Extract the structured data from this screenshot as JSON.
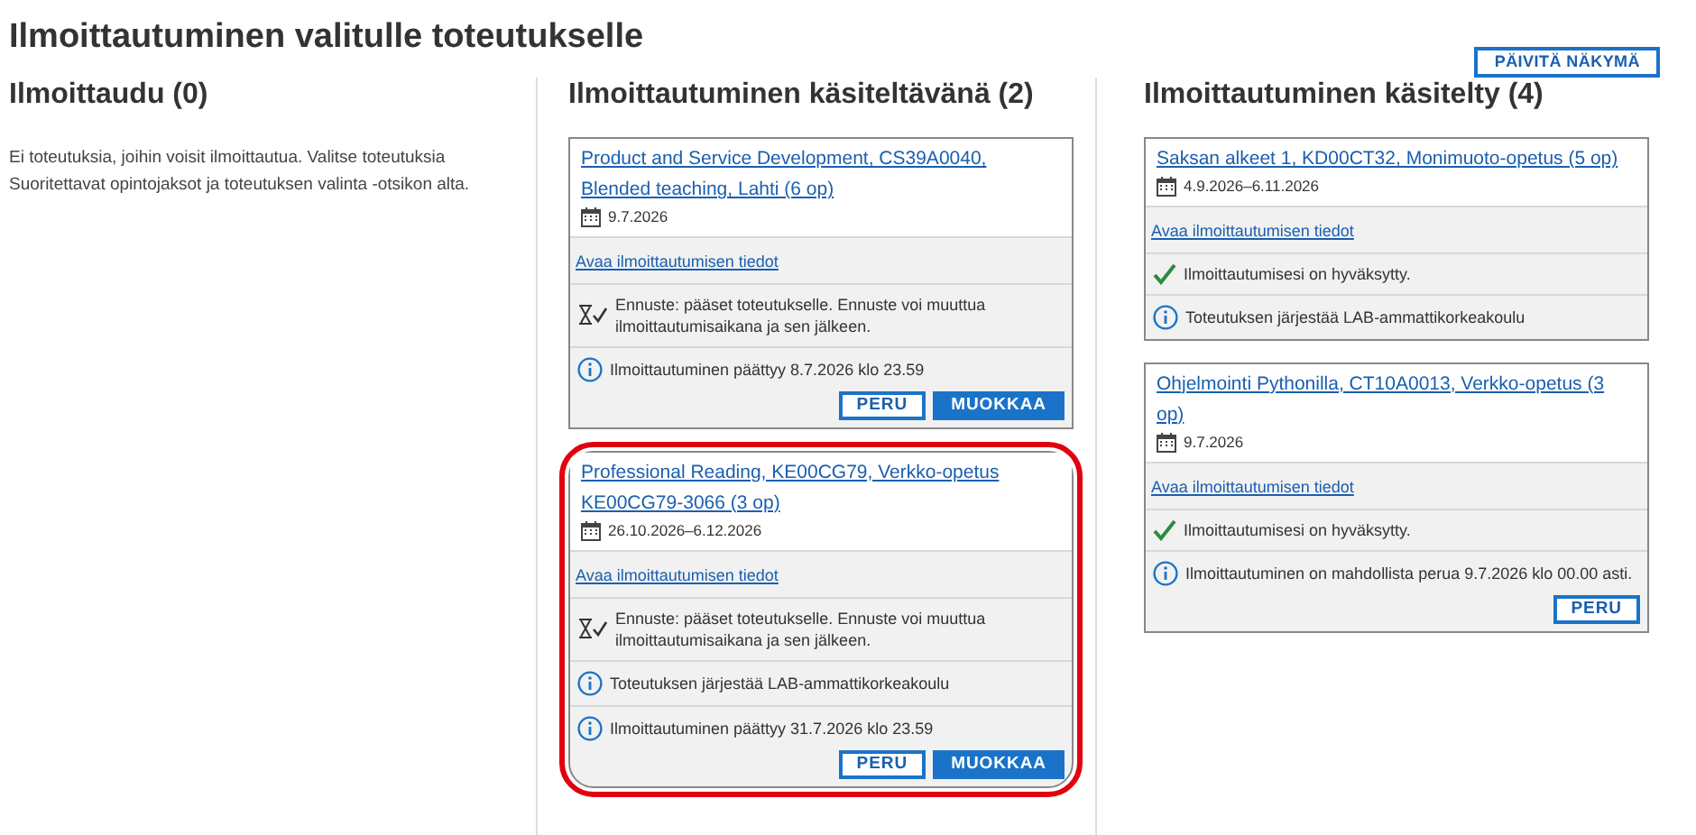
{
  "page_title": "Ilmoittautuminen valitulle toteutukselle",
  "refresh_button": "PÄIVITÄ NÄKYMÄ",
  "columns": [
    {
      "title": "Ilmoittaudu (0)",
      "text": "Ei toteutuksia, joihin voisit ilmoittautua. Valitse toteutuksia Suoritettavat opintojaksot ja toteutuksen valinta -otsikon alta."
    },
    {
      "title": "Ilmoittautuminen käsiteltävänä (2)",
      "cards": [
        {
          "title": "Product and Service Development, CS39A0040, Blended teaching, Lahti (6 op)",
          "date": "9.7.2026",
          "highlighted": false,
          "rows": [
            {
              "kind": "link",
              "text": "Avaa ilmoittautumisen tiedot"
            },
            {
              "kind": "forecast",
              "text": "Ennuste: pääset toteutukselle. Ennuste voi muuttua ilmoittautumisaikana ja sen jälkeen."
            },
            {
              "kind": "info",
              "text": "Ilmoittautuminen päättyy 8.7.2026 klo 23.59"
            }
          ],
          "buttons": [
            {
              "label": "PERU",
              "kind": "outline"
            },
            {
              "label": "MUOKKAA",
              "kind": "filled"
            }
          ]
        },
        {
          "title": "Professional Reading, KE00CG79, Verkko-opetus KE00CG79-3066 (3 op)",
          "date": "26.10.2026–6.12.2026",
          "highlighted": true,
          "rows": [
            {
              "kind": "link",
              "text": "Avaa ilmoittautumisen tiedot"
            },
            {
              "kind": "forecast",
              "text": "Ennuste: pääset toteutukselle. Ennuste voi muuttua ilmoittautumisaikana ja sen jälkeen."
            },
            {
              "kind": "info",
              "text": "Toteutuksen järjestää LAB-ammattikorkeakoulu"
            },
            {
              "kind": "info",
              "text": "Ilmoittautuminen päättyy 31.7.2026 klo 23.59"
            }
          ],
          "buttons": [
            {
              "label": "PERU",
              "kind": "outline"
            },
            {
              "label": "MUOKKAA",
              "kind": "filled"
            }
          ]
        }
      ]
    },
    {
      "title": "Ilmoittautuminen käsitelty (4)",
      "cards": [
        {
          "title": "Saksan alkeet 1, KD00CT32, Monimuoto-opetus (5 op)",
          "date": "4.9.2026–6.11.2026",
          "highlighted": false,
          "rows": [
            {
              "kind": "link",
              "text": "Avaa ilmoittautumisen tiedot"
            },
            {
              "kind": "accepted",
              "text": "Ilmoittautumisesi on hyväksytty."
            },
            {
              "kind": "info",
              "text": "Toteutuksen järjestää LAB-ammattikorkeakoulu"
            }
          ]
        },
        {
          "title": "Ohjelmointi Pythonilla, CT10A0013, Verkko-opetus (3 op)",
          "date": "9.7.2026",
          "highlighted": false,
          "rows": [
            {
              "kind": "link",
              "text": "Avaa ilmoittautumisen tiedot"
            },
            {
              "kind": "accepted",
              "text": "Ilmoittautumisesi on hyväksytty."
            },
            {
              "kind": "info",
              "text": "Ilmoittautuminen on mahdollista perua 9.7.2026 klo 00.00 asti."
            }
          ],
          "buttons": [
            {
              "label": "PERU",
              "kind": "outline"
            }
          ]
        }
      ]
    }
  ]
}
